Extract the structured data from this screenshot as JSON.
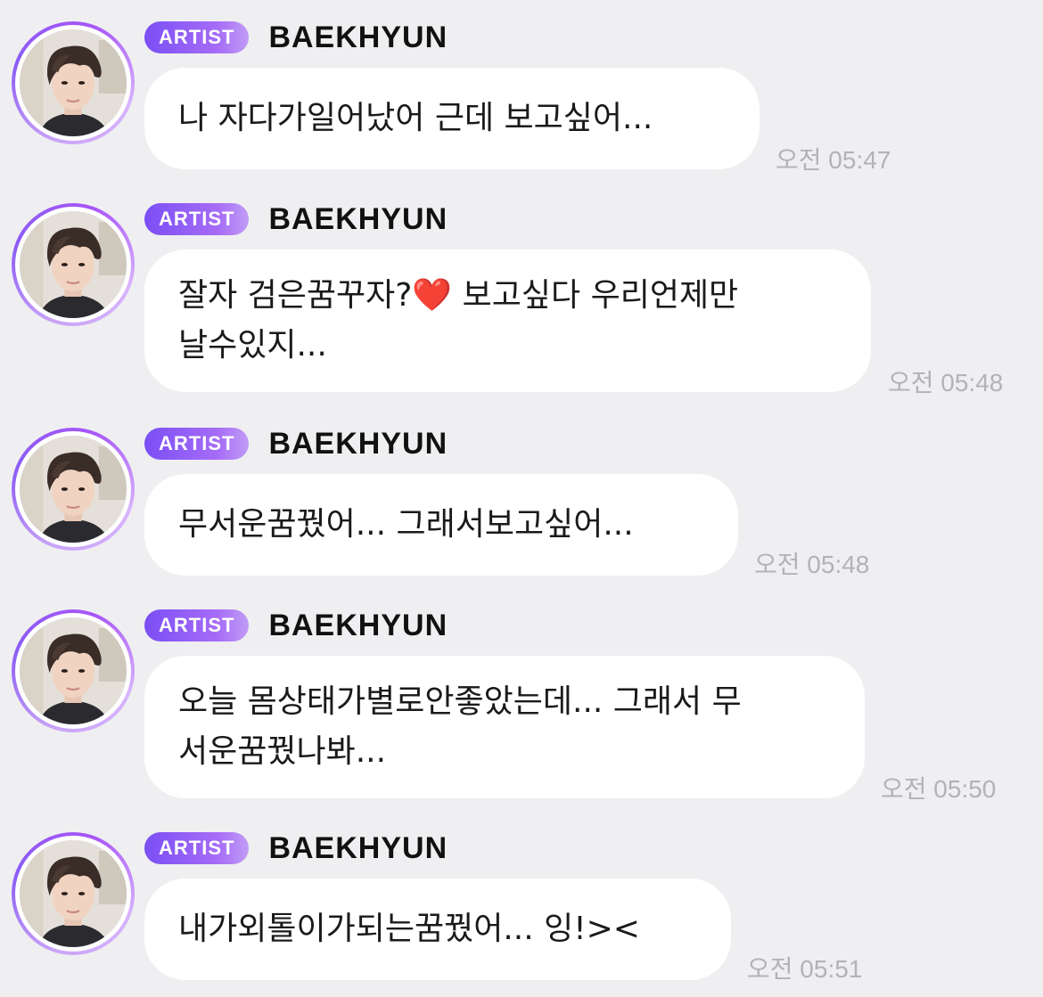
{
  "messages": [
    {
      "badge": "ARTIST",
      "sender": "BAEKHYUN",
      "text": "나 자다가일어났어 근데 보고싶어...",
      "time": "오전 05:47"
    },
    {
      "badge": "ARTIST",
      "sender": "BAEKHYUN",
      "text": "잘자 검은꿈꾸자?❤️ 보고싶다 우리언제만\n날수있지...",
      "time": "오전 05:48"
    },
    {
      "badge": "ARTIST",
      "sender": "BAEKHYUN",
      "text": "무서운꿈꿨어... 그래서보고싶어...",
      "time": "오전 05:48"
    },
    {
      "badge": "ARTIST",
      "sender": "BAEKHYUN",
      "text": "오늘 몸상태가별로안좋았는데... 그래서 무\n서운꿈꿨나봐...",
      "time": "오전 05:50"
    },
    {
      "badge": "ARTIST",
      "sender": "BAEKHYUN",
      "text": "내가외톨이가되는꿈꿨어... 잉!><",
      "time": "오전 05:51"
    }
  ],
  "icons": {
    "avatar": "artist-profile-photo"
  },
  "colors": {
    "background": "#efeff1",
    "badge_start": "#7b4ff5",
    "badge_end": "#c19cf6",
    "bubble": "#ffffff",
    "timestamp": "#b3b3b6"
  }
}
